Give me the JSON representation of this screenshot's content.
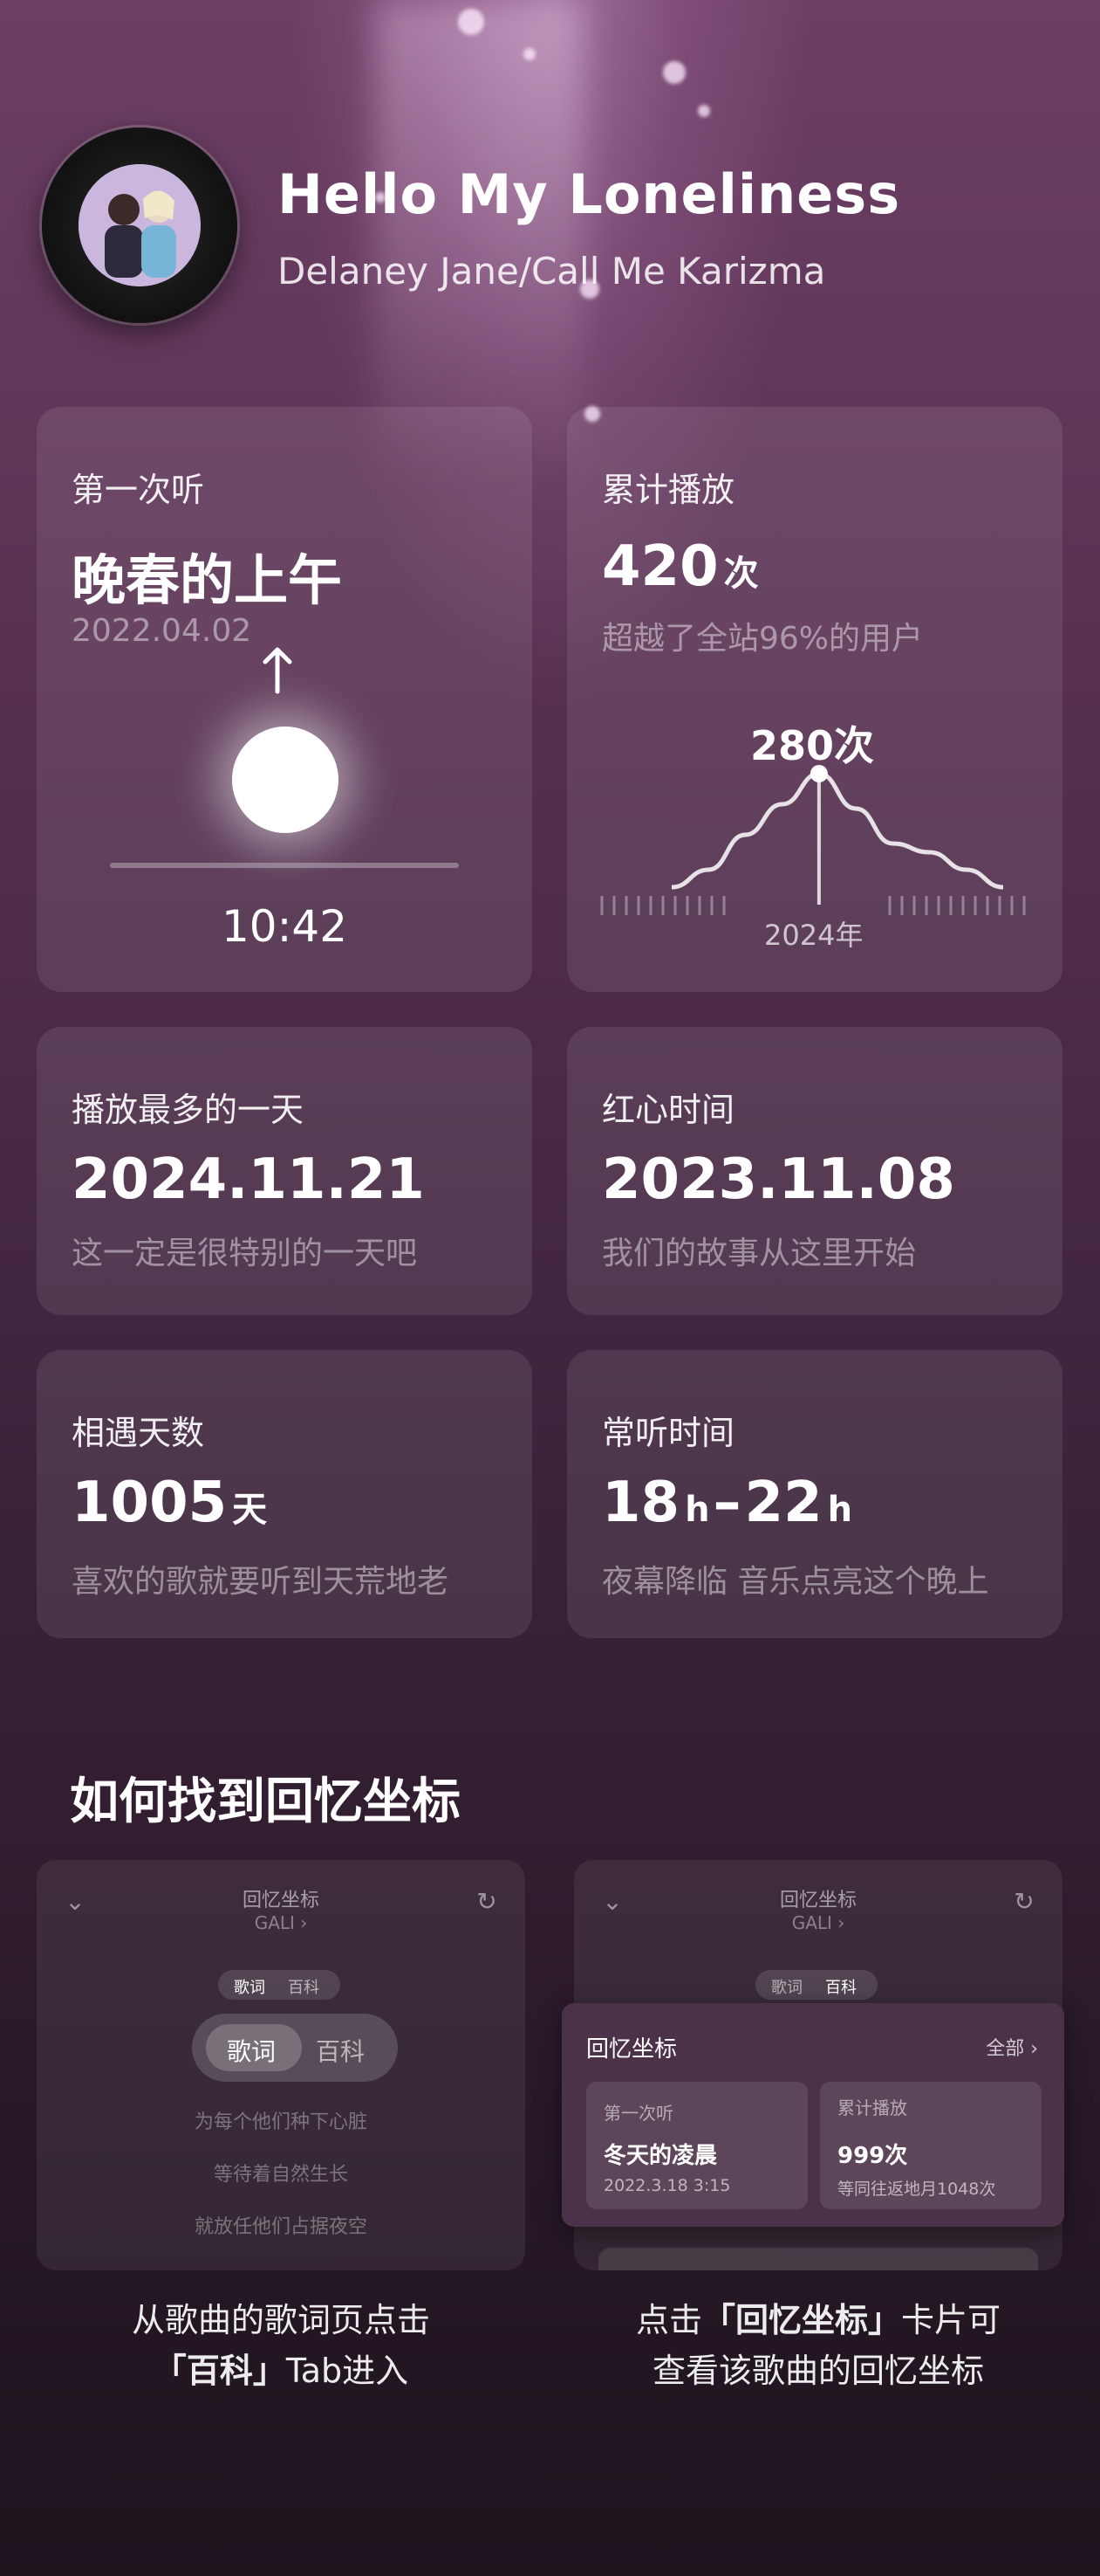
{
  "header": {
    "song_title": "Hello My Loneliness",
    "artist": "Delaney Jane/Call Me Karizma"
  },
  "cards": {
    "first_listen": {
      "label": "第一次听",
      "value": "晚春的上午",
      "date": "2022.04.02",
      "time": "10:42"
    },
    "total_plays": {
      "label": "累计播放",
      "value": "420",
      "unit": "次",
      "sub": "超越了全站96%的用户",
      "peak_value": "280次",
      "peak_year": "2024年"
    },
    "most_played_day": {
      "label": "播放最多的一天",
      "value": "2024.11.21",
      "sub": "这一定是很特别的一天吧"
    },
    "heart_time": {
      "label": "红心时间",
      "value": "2023.11.08",
      "sub": "我们的故事从这里开始"
    },
    "days_met": {
      "label": "相遇天数",
      "value": "1005",
      "unit": "天",
      "sub": "喜欢的歌就要听到天荒地老"
    },
    "listen_time": {
      "label": "常听时间",
      "from": "18",
      "from_unit": "h",
      "dash": "–",
      "to": "22",
      "to_unit": "h",
      "sub": "夜幕降临 音乐点亮这个晚上"
    }
  },
  "guide": {
    "title": "如何找到回忆坐标",
    "left": {
      "screen_title": "回忆坐标",
      "screen_sub": "GALI ›",
      "tab_lyrics": "歌词",
      "tab_wiki": "百科",
      "lyrics": [
        "为每个他们种下心脏",
        "等待着自然生长",
        "就放任他们占据夜空"
      ],
      "caption_line1": "从歌曲的歌词页点击",
      "caption_bracket_open": "「",
      "caption_bold": "百科",
      "caption_bracket_close": "」",
      "caption_line2_rest": "Tab进入"
    },
    "right": {
      "screen_title": "回忆坐标",
      "screen_sub": "GALI ›",
      "tab_lyrics": "歌词",
      "tab_wiki": "百科",
      "panel_title": "回忆坐标",
      "panel_all": "全部 ›",
      "mini_card1": {
        "label": "第一次听",
        "value": "冬天的凌晨",
        "sub": "2022.3.18 3:15"
      },
      "mini_card2": {
        "label": "累计播放",
        "value": "999次",
        "sub": "等同往返地月1048次"
      },
      "caption_line1_pre": "点击",
      "caption_bracket_open": "「",
      "caption_bold": "回忆坐标",
      "caption_bracket_close": "」",
      "caption_line1_post": "卡片可",
      "caption_line2": "查看该歌曲的回忆坐标"
    }
  },
  "chart_data": {
    "type": "line",
    "highlight": {
      "label": "280次",
      "x": "2024年"
    },
    "series": [
      {
        "values": [
          20,
          60,
          140,
          210,
          280,
          200,
          120,
          100,
          60,
          20
        ]
      }
    ]
  },
  "first_listen_timeline": {
    "sun_position_fraction": 0.5
  }
}
